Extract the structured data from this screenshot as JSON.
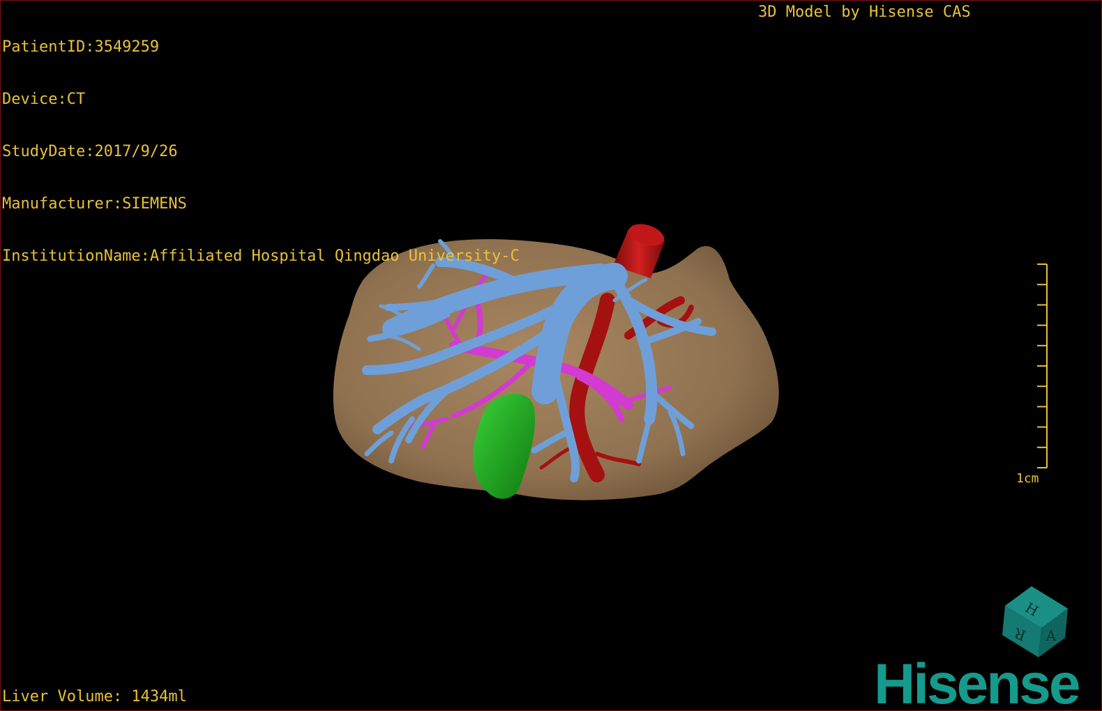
{
  "overlay": {
    "patient_id": "PatientID:3549259",
    "device": "Device:CT",
    "study_date": "StudyDate:2017/9/26",
    "manufacturer": "Manufacturer:SIEMENS",
    "institution": "InstitutionName:Affiliated Hospital Qingdao University-C",
    "model_credit": "3D Model by Hisense CAS",
    "liver_volume": "Liver Volume: 1434ml"
  },
  "scale_bar": {
    "label": "1cm",
    "tick_count": 11
  },
  "orientation_cube": {
    "faces": [
      "H",
      "R",
      "A"
    ]
  },
  "brand": {
    "name": "Hisense"
  },
  "colors": {
    "text": "#e8c23a",
    "liver": "#9b7b55",
    "portal_vein": "#6f9fd8",
    "hepatic_artery": "#d23ad2",
    "ivc": "#b01515",
    "gallbladder": "#1aa51a",
    "brand": "#159a8c",
    "frame": "#7a1212"
  }
}
